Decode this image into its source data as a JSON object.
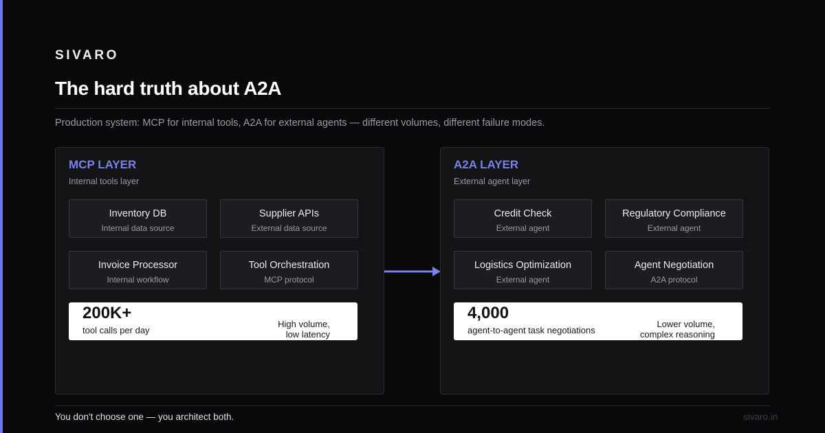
{
  "brand": "SIVARO",
  "title": "The hard truth about A2A",
  "subtitle": "Production system: MCP for internal tools, A2A for external agents — different volumes, different failure modes.",
  "colors": {
    "background": "#09090b",
    "accent": "#6f74e8",
    "panel": "#141417",
    "node": "#1d1d21",
    "stat_card": "#ffffff"
  },
  "panels": [
    {
      "title": "MCP LAYER",
      "subtitle": "Internal tools layer",
      "nodes": [
        {
          "name": "Inventory DB",
          "desc": "Internal data source"
        },
        {
          "name": "Supplier APIs",
          "desc": "External data source"
        },
        {
          "name": "Invoice Processor",
          "desc": "Internal workflow"
        },
        {
          "name": "Tool Orchestration",
          "desc": "MCP protocol"
        }
      ],
      "stat": {
        "value": "200K+",
        "label": "tool calls per day",
        "note_line1": "High volume,",
        "note_line2": "low latency"
      }
    },
    {
      "title": "A2A LAYER",
      "subtitle": "External agent layer",
      "nodes": [
        {
          "name": "Credit Check",
          "desc": "External agent"
        },
        {
          "name": "Regulatory Compliance",
          "desc": "External agent"
        },
        {
          "name": "Logistics Optimization",
          "desc": "External agent"
        },
        {
          "name": "Agent Negotiation",
          "desc": "A2A protocol"
        }
      ],
      "stat": {
        "value": "4,000",
        "label": "agent-to-agent task negotiations",
        "note_line1": "Lower volume,",
        "note_line2": "complex reasoning"
      }
    }
  ],
  "connector_icon": "arrow-right-icon",
  "footer": "You don't choose one — you architect both.",
  "site": "sivaro.in"
}
